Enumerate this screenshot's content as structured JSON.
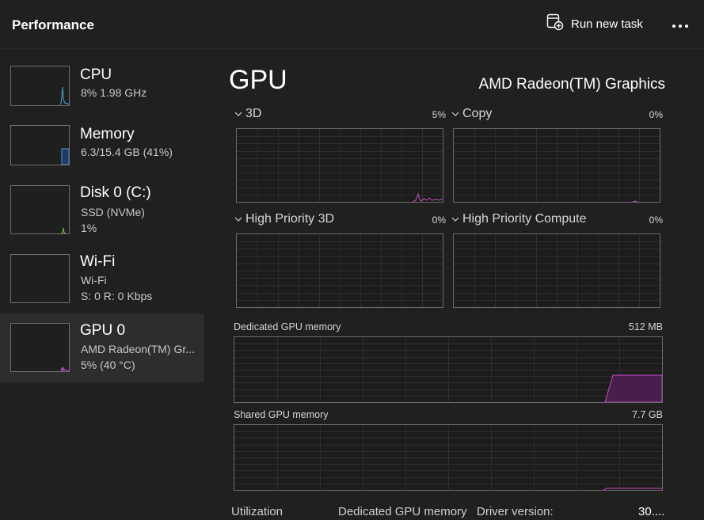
{
  "header": {
    "title": "Performance",
    "run_new_task": "Run new task",
    "more": "•••"
  },
  "sidebar": {
    "items": [
      {
        "name": "CPU",
        "sub1": "8%  1.98 GHz",
        "sub2": ""
      },
      {
        "name": "Memory",
        "sub1": "6.3/15.4 GB (41%)",
        "sub2": ""
      },
      {
        "name": "Disk 0 (C:)",
        "sub1": "SSD (NVMe)",
        "sub2": "1%"
      },
      {
        "name": "Wi-Fi",
        "sub1": "Wi-Fi",
        "sub2": "S: 0  R: 0 Kbps"
      },
      {
        "name": "GPU 0",
        "sub1": "AMD Radeon(TM) Gr...",
        "sub2": "5%  (40 °C)"
      }
    ],
    "selected_index": 4,
    "colors": {
      "cpu": "#4aa8d8",
      "memory": "#5b8fe0",
      "disk": "#6bbf3a",
      "gpu": "#c04fc0"
    }
  },
  "main": {
    "title": "GPU",
    "model": "AMD Radeon(TM) Graphics",
    "engines": [
      {
        "label": "3D",
        "value": "5%"
      },
      {
        "label": "Copy",
        "value": "0%"
      },
      {
        "label": "High Priority 3D",
        "value": "0%"
      },
      {
        "label": "High Priority Compute",
        "value": "0%"
      }
    ],
    "dedicated_memory": {
      "label": "Dedicated GPU memory",
      "max": "512 MB"
    },
    "shared_memory": {
      "label": "Shared GPU memory",
      "max": "7.7 GB"
    },
    "bottom": {
      "utilization": "Utilization",
      "dedicated": "Dedicated GPU memory",
      "driver_version_label": "Driver version:",
      "driver_version_value": "30...."
    },
    "accent_color": "#c04fc0"
  }
}
